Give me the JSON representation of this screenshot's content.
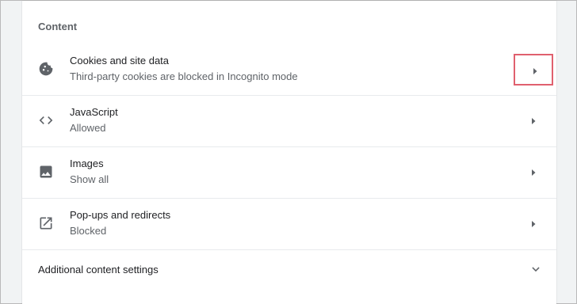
{
  "section": {
    "title": "Content"
  },
  "rows": [
    {
      "title": "Cookies and site data",
      "subtitle": "Third-party cookies are blocked in Incognito mode",
      "icon": "cookie-icon"
    },
    {
      "title": "JavaScript",
      "subtitle": "Allowed",
      "icon": "code-icon"
    },
    {
      "title": "Images",
      "subtitle": "Show all",
      "icon": "image-icon"
    },
    {
      "title": "Pop-ups and redirects",
      "subtitle": "Blocked",
      "icon": "open-in-new-icon"
    }
  ],
  "additional": {
    "label": "Additional content settings",
    "icon": "chevron-down-icon"
  },
  "colors": {
    "highlight_box": "#e0606e",
    "icon": "#5f6368",
    "title_text": "#202124",
    "subtitle_text": "#5f6368"
  }
}
